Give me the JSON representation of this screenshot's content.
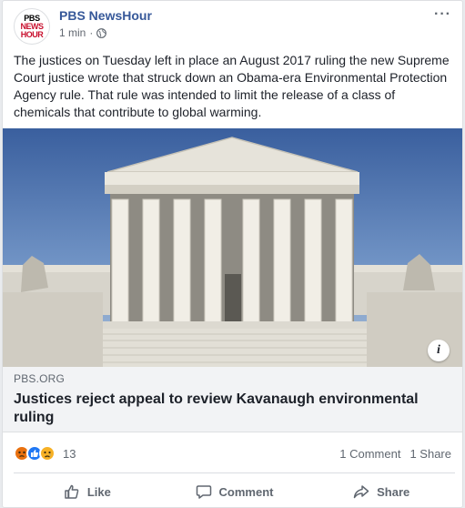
{
  "post": {
    "page_name": "PBS NewsHour",
    "logo": {
      "line1": "PBS",
      "line2": "NEWS",
      "line3": "HOUR"
    },
    "timestamp": "1 min",
    "separator": "·",
    "privacy_icon": "globe-icon",
    "more_label": "···",
    "text": "The justices on Tuesday left in place an August 2017 ruling the new Supreme Court justice wrote that struck down an Obama-era Environmental Protection Agency rule. That rule was intended to limit the release of a class of chemicals that contribute to global warming."
  },
  "link": {
    "image_icon": "supreme-court-building-photo",
    "info_label": "i",
    "domain": "PBS.ORG",
    "title": "Justices reject appeal to review Kavanaugh environmental ruling"
  },
  "engagement": {
    "reaction_icons": [
      "angry-icon",
      "like-icon",
      "sad-icon"
    ],
    "reaction_count": "13",
    "comments": "1 Comment",
    "shares": "1 Share"
  },
  "actions": {
    "like_label": "Like",
    "comment_label": "Comment",
    "share_label": "Share"
  },
  "colors": {
    "page_name": "#365899",
    "brand_red": "#c8102e",
    "angry": "#e9710f",
    "like": "#2078f4",
    "sad": "#f7b125"
  }
}
